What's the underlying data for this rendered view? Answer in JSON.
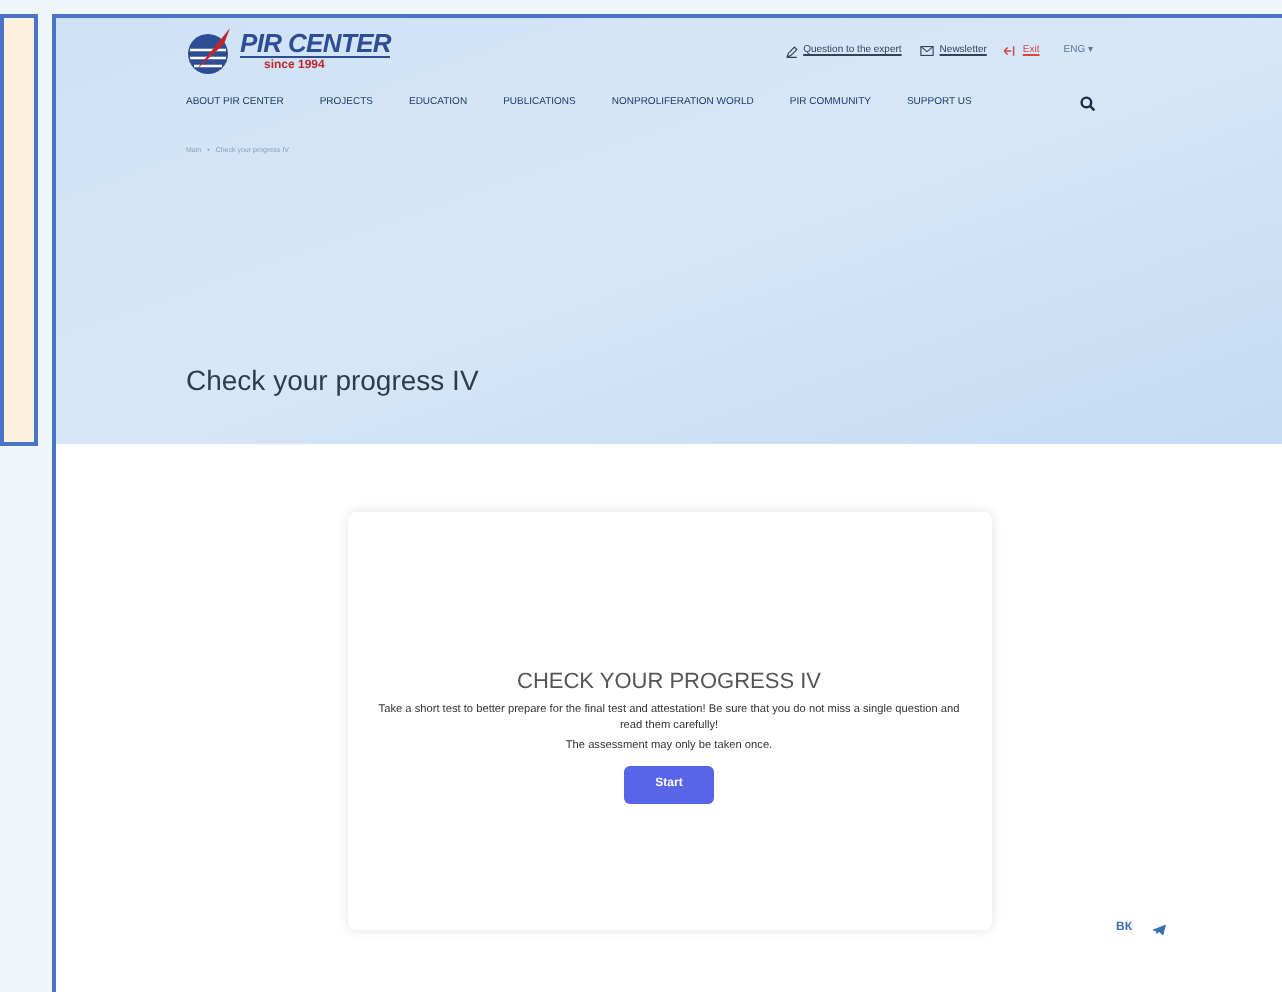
{
  "logo": {
    "name": "PIR CENTER",
    "tagline": "since 1994"
  },
  "top_links": [
    {
      "kind": "expert",
      "label": "Question to the expert"
    },
    {
      "kind": "newsletter",
      "label": "Newsletter"
    },
    {
      "kind": "exit",
      "label": "Exit"
    }
  ],
  "language": {
    "label": "ENG",
    "caret": "▾"
  },
  "nav": [
    "ABOUT PIR CENTER",
    "PROJECTS",
    "EDUCATION",
    "PUBLICATIONS",
    "NONPROLIFERATION WORLD",
    "PIR COMMUNITY",
    "SUPPORT US"
  ],
  "breadcrumb": {
    "items": [
      "Main",
      "Check your progress IV"
    ],
    "separator": "•"
  },
  "page_title": "Check your progress IV",
  "card": {
    "heading": "CHECK YOUR PROGRESS IV",
    "description": "Take a short test to better prepare for the final test and attestation! Be sure that you do not miss a single question and read them carefully!",
    "note": "The assessment may only be taken once.",
    "button": "Start"
  },
  "social": [
    {
      "kind": "vk",
      "label": "ВК"
    },
    {
      "kind": "telegram"
    }
  ]
}
